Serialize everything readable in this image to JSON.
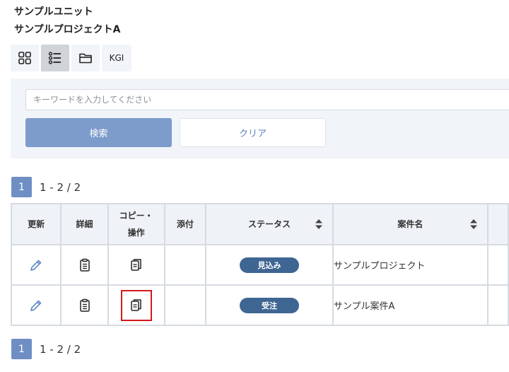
{
  "breadcrumb": {
    "unit": "サンプルユニット",
    "project": "サンプルプロジェクトA"
  },
  "view_toggle": {
    "buttons": [
      {
        "icon": "grid-view-icon",
        "active": false
      },
      {
        "icon": "list-view-icon",
        "active": true
      },
      {
        "icon": "folder-icon",
        "active": false
      },
      {
        "label": "KGI",
        "active": false
      }
    ]
  },
  "search": {
    "placeholder": "キーワードを入力してください",
    "value": "",
    "search_label": "検索",
    "clear_label": "クリア"
  },
  "pagination": {
    "current_page": "1",
    "range": "1 - 2 / 2"
  },
  "table": {
    "headers": {
      "update": "更新",
      "detail": "詳細",
      "copy_line1": "コピー・",
      "copy_line2": "操作",
      "attachment": "添付",
      "status": "ステータス",
      "case_name": "案件名"
    },
    "rows": [
      {
        "status": "見込み",
        "case_name": "サンプルプロジェクト",
        "copy_highlighted": false
      },
      {
        "status": "受注",
        "case_name": "サンプル案件A",
        "copy_highlighted": true
      }
    ]
  },
  "colors": {
    "accent": "#7d9bcb",
    "pager": "#6f8fc4",
    "status_badge": "#3f6593",
    "highlight": "#d0191b",
    "edit_icon": "#4f7cc4"
  }
}
